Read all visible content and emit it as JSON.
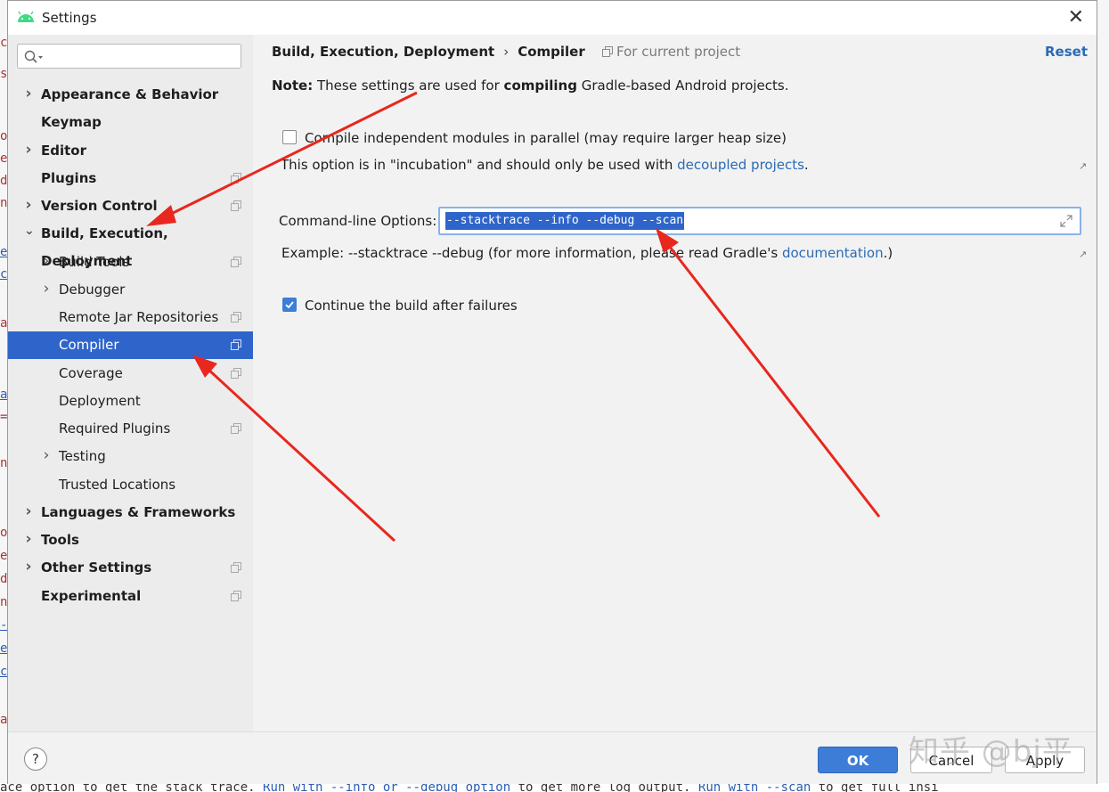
{
  "window": {
    "title": "Settings"
  },
  "sidebar": {
    "items": [
      {
        "label": "Appearance & Behavior",
        "level": 0,
        "expandable": true,
        "expanded": false,
        "bold": true,
        "project_scope": false
      },
      {
        "label": "Keymap",
        "level": 0,
        "expandable": false,
        "bold": true,
        "project_scope": false
      },
      {
        "label": "Editor",
        "level": 0,
        "expandable": true,
        "expanded": false,
        "bold": true,
        "project_scope": false
      },
      {
        "label": "Plugins",
        "level": 0,
        "expandable": false,
        "bold": true,
        "project_scope": true
      },
      {
        "label": "Version Control",
        "level": 0,
        "expandable": true,
        "expanded": false,
        "bold": true,
        "project_scope": true
      },
      {
        "label": "Build, Execution, Deployment",
        "level": 0,
        "expandable": true,
        "expanded": true,
        "bold": true,
        "project_scope": false
      },
      {
        "label": "Build Tools",
        "level": 1,
        "expandable": true,
        "expanded": false,
        "bold": false,
        "project_scope": true
      },
      {
        "label": "Debugger",
        "level": 1,
        "expandable": true,
        "expanded": false,
        "bold": false,
        "project_scope": false
      },
      {
        "label": "Remote Jar Repositories",
        "level": 1,
        "expandable": false,
        "bold": false,
        "project_scope": true
      },
      {
        "label": "Compiler",
        "level": 1,
        "expandable": false,
        "bold": false,
        "project_scope": true,
        "selected": true
      },
      {
        "label": "Coverage",
        "level": 1,
        "expandable": false,
        "bold": false,
        "project_scope": true
      },
      {
        "label": "Deployment",
        "level": 1,
        "expandable": false,
        "bold": false,
        "project_scope": false
      },
      {
        "label": "Required Plugins",
        "level": 1,
        "expandable": false,
        "bold": false,
        "project_scope": true
      },
      {
        "label": "Testing",
        "level": 1,
        "expandable": true,
        "expanded": false,
        "bold": false,
        "project_scope": false
      },
      {
        "label": "Trusted Locations",
        "level": 1,
        "expandable": false,
        "bold": false,
        "project_scope": false
      },
      {
        "label": "Languages & Frameworks",
        "level": 0,
        "expandable": true,
        "expanded": false,
        "bold": true,
        "project_scope": false
      },
      {
        "label": "Tools",
        "level": 0,
        "expandable": true,
        "expanded": false,
        "bold": true,
        "project_scope": false
      },
      {
        "label": "Other Settings",
        "level": 0,
        "expandable": true,
        "expanded": false,
        "bold": true,
        "project_scope": true
      },
      {
        "label": "Experimental",
        "level": 0,
        "expandable": false,
        "bold": true,
        "project_scope": true
      }
    ]
  },
  "content": {
    "breadcrumb": {
      "parent": "Build, Execution, Deployment",
      "separator": "›",
      "current": "Compiler"
    },
    "scope_label": "For current project",
    "reset_label": "Reset",
    "note": {
      "prefix": "Note:",
      "before": "These settings are used for ",
      "emph": "compiling",
      "after": " Gradle-based Android projects."
    },
    "parallel_option": {
      "label": "Compile independent modules in parallel (may require larger heap size)",
      "checked": false,
      "hint_before": "This option is in \"incubation\" and should only be used with ",
      "hint_link": "decoupled projects",
      "hint_after": "."
    },
    "command_line": {
      "label": "Command-line Options:",
      "value": "--stacktrace --info --debug --scan",
      "example_before": "Example: --stacktrace --debug (for more information, please read Gradle's ",
      "example_link": "documentation",
      "example_after": ".)"
    },
    "continue_option": {
      "label": "Continue the build after failures",
      "checked": true
    }
  },
  "footer": {
    "help_label": "?",
    "ok_label": "OK",
    "cancel_label": "Cancel",
    "apply_label": "Apply"
  },
  "watermark": "知乎 @bj平",
  "background": {
    "bottom_console": [
      {
        "text": "ace option to get the stack trace. ",
        "link": false
      },
      {
        "text": "Run with --info or --debug option",
        "link": true
      },
      {
        "text": " to get more log output. ",
        "link": false
      },
      {
        "text": "Run with --scan",
        "link": true
      },
      {
        "text": " to get full insi",
        "link": false
      }
    ]
  },
  "colors": {
    "accent": "#2f65ca",
    "link": "#2a6bb5",
    "arrow": "#e8271e"
  }
}
